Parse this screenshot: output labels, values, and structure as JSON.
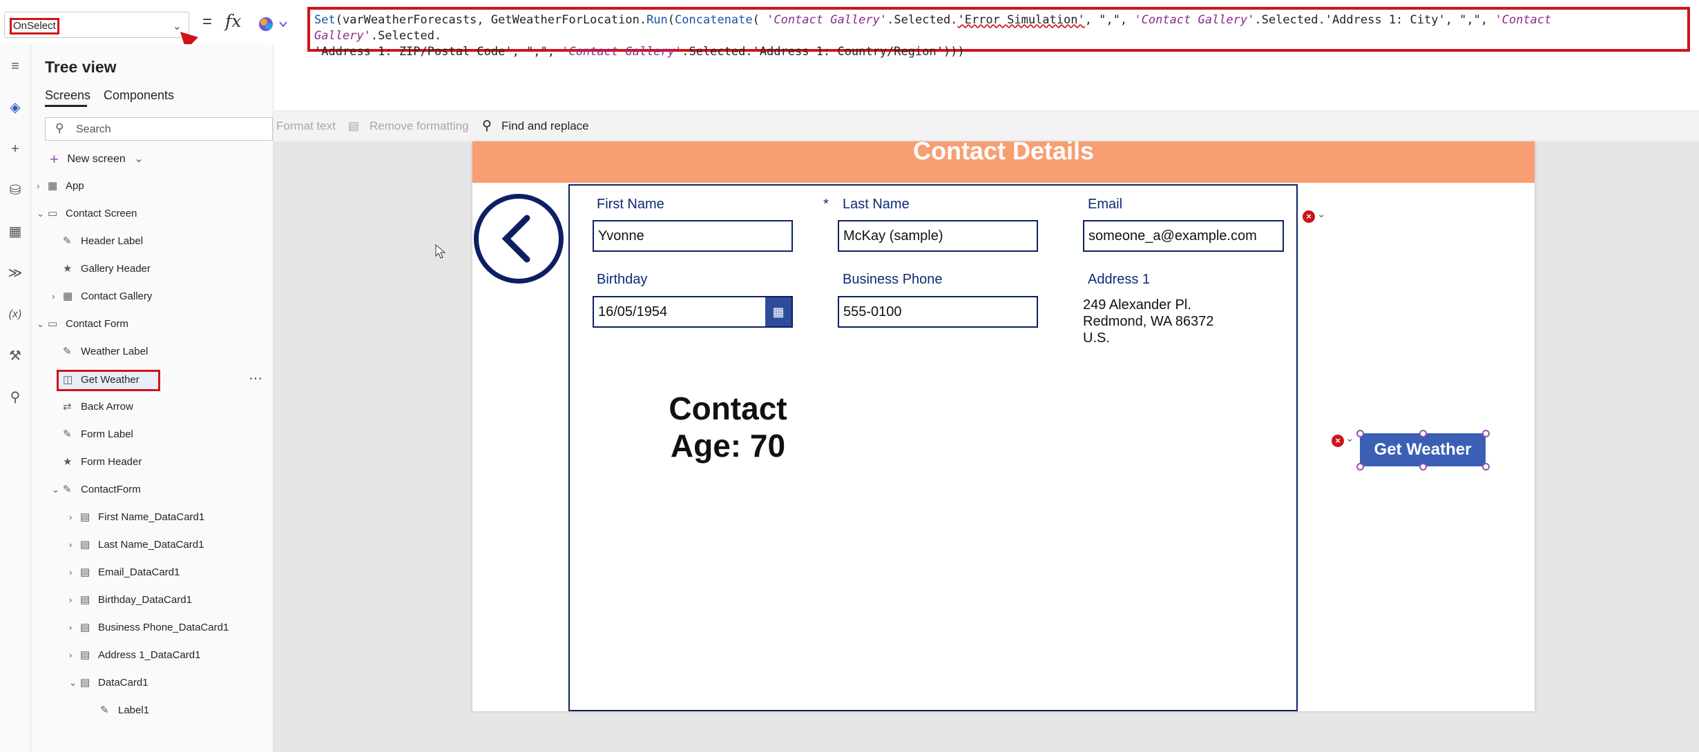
{
  "formula_bar": {
    "property": "OnSelect",
    "equals": "=",
    "fx": "fx",
    "formula": {
      "p1": "Set",
      "p2": "(varWeatherForecasts, GetWeatherForLocation.",
      "p3": "Run",
      "p4": "(",
      "p5": "Concatenate",
      "p6": "( ",
      "p7": "'Contact Gallery'",
      "p8": ".Selected.",
      "p9": "'Error Simulation'",
      "p10": ", \",\", ",
      "p11": "'Contact Gallery'",
      "p12": ".Selected.'Address 1: City', \",\", ",
      "p13": "'Contact Gallery'",
      "p14": ".Selected.\n'Address 1: ZIP/Postal Code', \",\", ",
      "p15": "'Contact Gallery'",
      "p16": ".Selected.'Address 1: Country/Region')))"
    }
  },
  "toolbar": {
    "format_text": "Format text",
    "remove_formatting": "Remove formatting",
    "find_replace": "Find and replace"
  },
  "tree": {
    "title": "Tree view",
    "tab_screens": "Screens",
    "tab_components": "Components",
    "search_placeholder": "Search",
    "new_screen": "New screen",
    "nodes": [
      "App",
      "Contact Screen",
      "Header Label",
      "Gallery Header",
      "Contact Gallery",
      "Contact Form",
      "Weather Label",
      "Get Weather",
      "Back Arrow",
      "Form Label",
      "Form Header",
      "ContactForm",
      "First Name_DataCard1",
      "Last Name_DataCard1",
      "Email_DataCard1",
      "Birthday_DataCard1",
      "Business Phone_DataCard1",
      "Address 1_DataCard1",
      "DataCard1",
      "Label1"
    ]
  },
  "canvas": {
    "header": "Contact Details",
    "fields": {
      "first_name_label": "First Name",
      "first_name_value": "Yvonne",
      "required_mark": "*",
      "last_name_label": "Last Name",
      "last_name_value": "McKay (sample)",
      "email_label": "Email",
      "email_value": "someone_a@example.com",
      "birthday_label": "Birthday",
      "birthday_value": "16/05/1954",
      "phone_label": "Business Phone",
      "phone_value": "555-0100",
      "address_label": "Address 1",
      "address_line1": "249 Alexander Pl.",
      "address_line2": "Redmond, WA 86372",
      "address_line3": "U.S."
    },
    "age_line1": "Contact",
    "age_line2": "Age: 70",
    "weather_button": "Get Weather"
  }
}
